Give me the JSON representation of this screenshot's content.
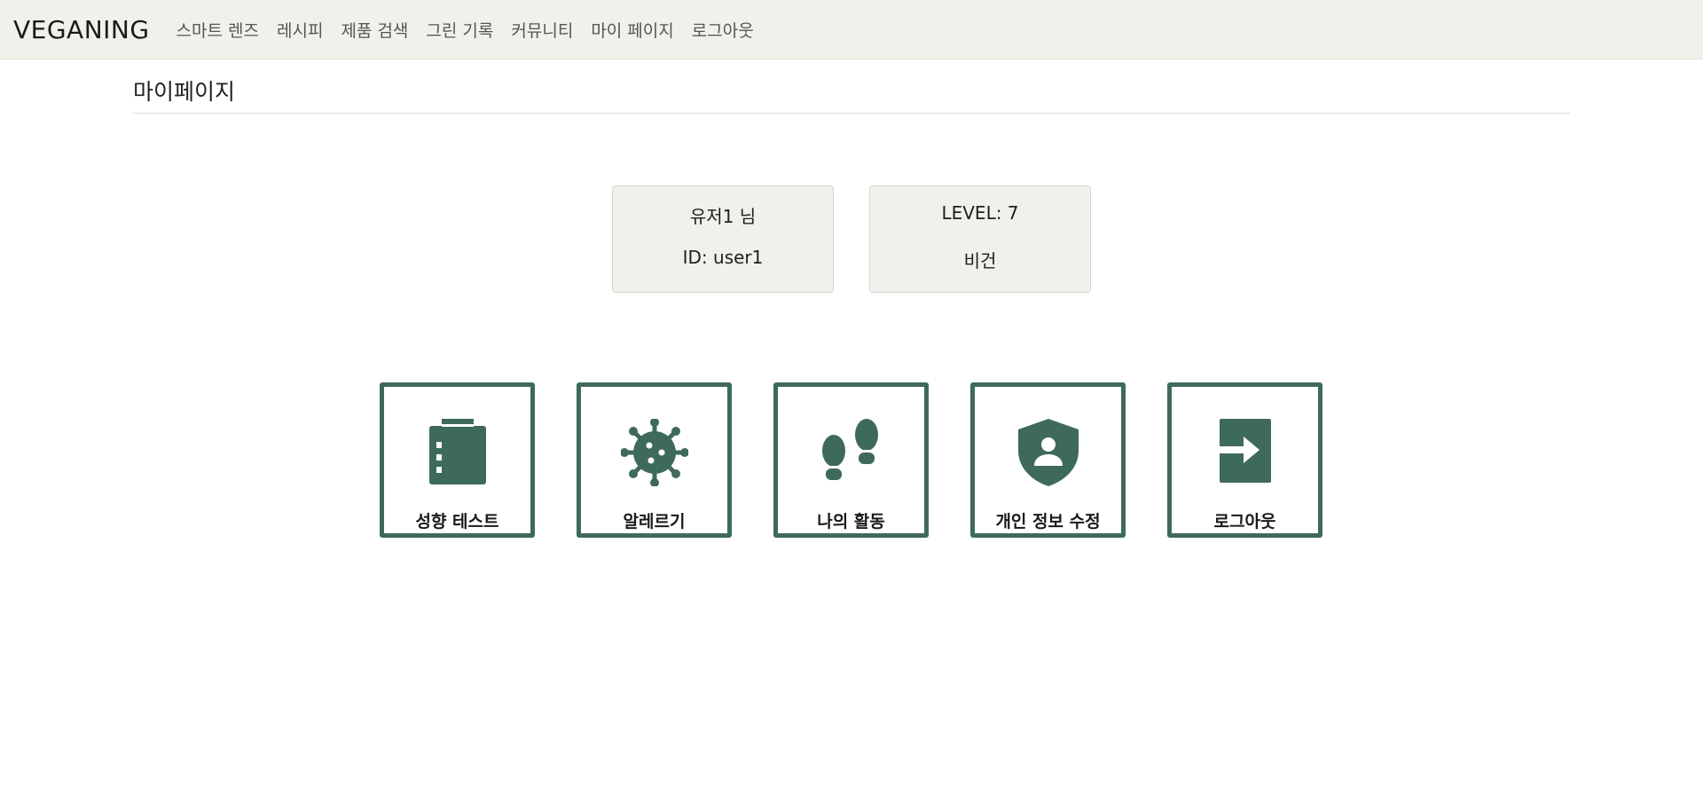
{
  "navbar": {
    "brand": "VEGANING",
    "links": [
      "스마트 렌즈",
      "레시피",
      "제품 검색",
      "그린 기록",
      "커뮤니티",
      "마이 페이지",
      "로그아웃"
    ]
  },
  "page": {
    "title": "마이페이지"
  },
  "profile": {
    "name": "유저1 님",
    "id": "ID: user1",
    "level": "LEVEL: 7",
    "type": "비건"
  },
  "menu": {
    "items": [
      {
        "label": "성향 테스트",
        "icon": "clipboard-icon"
      },
      {
        "label": "알레르기",
        "icon": "virus-icon"
      },
      {
        "label": "나의 활동",
        "icon": "footprints-icon"
      },
      {
        "label": "개인 정보 수정",
        "icon": "shield-person-icon"
      },
      {
        "label": "로그아웃",
        "icon": "logout-icon"
      }
    ]
  },
  "colors": {
    "navbar_bg": "#f1f0ea",
    "accent": "#3e6a5c",
    "card_bg": "#f1f0ea"
  }
}
